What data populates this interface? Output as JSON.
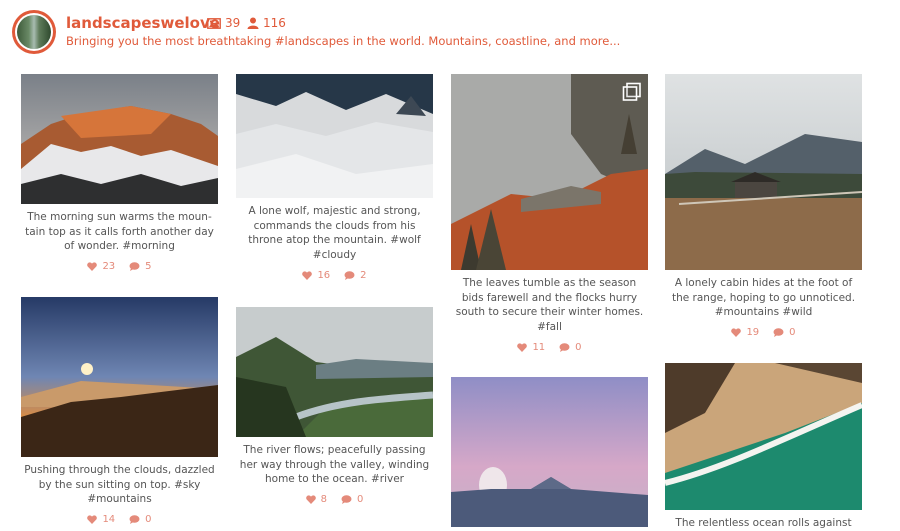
{
  "profile": {
    "username": "landscapeswelove",
    "media_count": "39",
    "followers_count": "116",
    "bio": "Bringing you the most breathtaking #landscapes in the world. Mountains, coastline, and more..."
  },
  "posts": [
    {
      "caption": "The morning sun warms the moun-tain top as it calls forth another day of wonder. #morning",
      "likes": "23",
      "comments": "5"
    },
    {
      "caption": "A lone wolf, majestic and strong, commands the clouds from his throne atop the mountain. #wolf #cloudy",
      "likes": "16",
      "comments": "2"
    },
    {
      "caption": "The leaves tumble as the season bids farewell and the flocks hurry south to secure their winter homes. #fall",
      "likes": "11",
      "comments": "0"
    },
    {
      "caption": "A lonely cabin hides at the foot of the range, hoping to go unnoticed. #mountains #wild",
      "likes": "19",
      "comments": "0"
    },
    {
      "caption": "Pushing through the clouds, dazzled by the sun sitting on top. #sky #mountains",
      "likes": "14",
      "comments": "0"
    },
    {
      "caption": "The river flows; peacefully passing her way through the valley, winding home to the ocean. #river",
      "likes": "8",
      "comments": "0"
    },
    {
      "caption": "",
      "likes": "",
      "comments": ""
    },
    {
      "caption": "The relentless ocean rolls against",
      "likes": "",
      "comments": ""
    }
  ],
  "colors": {
    "accent": "#e05a3a",
    "meta": "#e48a7a"
  },
  "icons": [
    "image-icon",
    "person-icon",
    "heart-icon",
    "comment-icon",
    "multiple-images-icon"
  ]
}
